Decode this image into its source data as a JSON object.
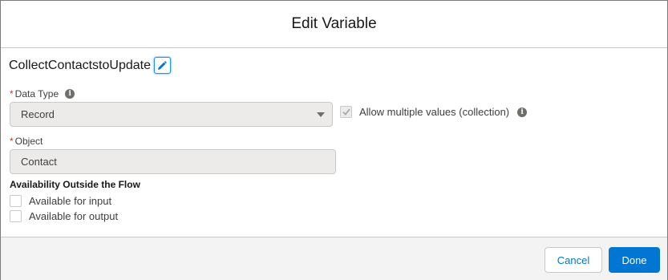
{
  "modal": {
    "title": "Edit Variable"
  },
  "variable": {
    "name": "CollectContactstoUpdate"
  },
  "data_type": {
    "required_mark": "*",
    "label": "Data Type",
    "value": "Record"
  },
  "multiple_values": {
    "label": "Allow multiple values (collection)",
    "checked": true
  },
  "object": {
    "required_mark": "*",
    "label": "Object",
    "value": "Contact"
  },
  "availability": {
    "title": "Availability Outside the Flow",
    "input_label": "Available for input",
    "output_label": "Available for output"
  },
  "footer": {
    "cancel_label": "Cancel",
    "done_label": "Done"
  },
  "colors": {
    "brand": "#0176d3",
    "required": "#c23934",
    "focus": "#1b96ff"
  },
  "icons": {
    "edit": "pencil-icon",
    "info": "info-icon",
    "dropdown": "caret-down-icon",
    "check": "checkmark-icon"
  }
}
